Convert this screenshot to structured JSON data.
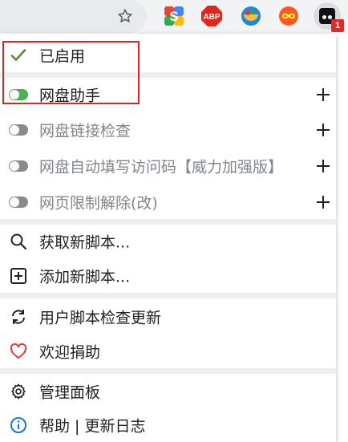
{
  "toolbar": {
    "bookmark_icon": "star-outline-icon",
    "extensions": [
      {
        "name": "sider-extension",
        "icon": "s-logo-icon"
      },
      {
        "name": "adblock-plus-extension",
        "icon": "abp-icon",
        "text": "ABP"
      },
      {
        "name": "bowl-extension",
        "icon": "bowl-icon"
      },
      {
        "name": "infinity-extension",
        "icon": "infinity-icon"
      },
      {
        "name": "tampermonkey-extension",
        "icon": "tampermonkey-icon"
      }
    ],
    "badge_count": "1"
  },
  "menu": {
    "enabled_label": "已启用",
    "scripts": [
      {
        "label": "网盘助手",
        "enabled": true
      },
      {
        "label": "网盘链接检查",
        "enabled": false
      },
      {
        "label": "网盘自动填写访问码【威力加强版】",
        "enabled": false
      },
      {
        "label": "网页限制解除(改)",
        "enabled": false
      }
    ],
    "get_new_scripts": "获取新脚本...",
    "add_new_script": "添加新脚本...",
    "check_updates": "用户脚本检查更新",
    "donate": "欢迎捐助",
    "dashboard": "管理面板",
    "help": "帮助 | 更新日志"
  },
  "colors": {
    "accent_green": "#4caf50",
    "checkmark": "#558b2f",
    "highlight_border": "#e02020",
    "badge": "#dd2b2b",
    "link_blue": "#1a73e8"
  }
}
